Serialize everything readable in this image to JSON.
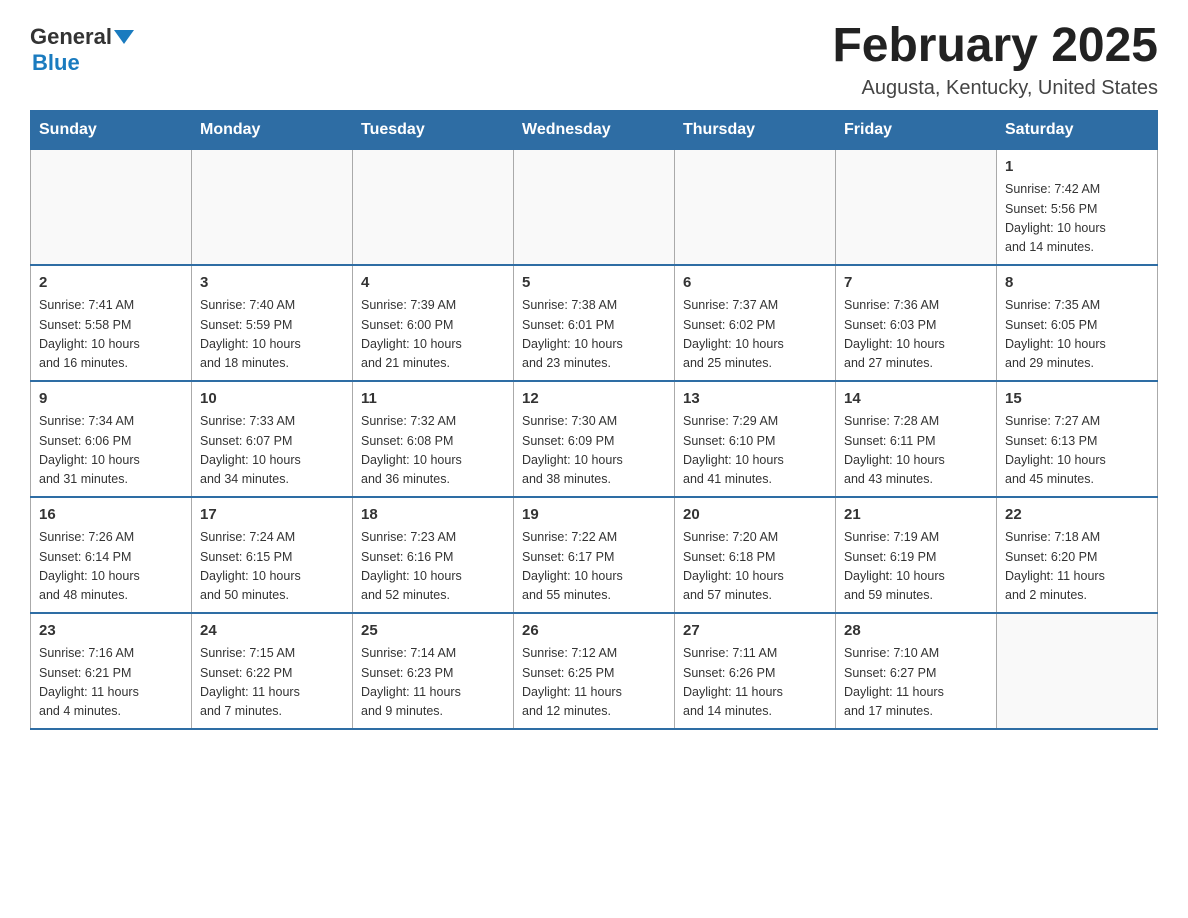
{
  "header": {
    "logo": {
      "general": "General",
      "blue": "Blue"
    },
    "title": "February 2025",
    "subtitle": "Augusta, Kentucky, United States"
  },
  "weekdays": [
    "Sunday",
    "Monday",
    "Tuesday",
    "Wednesday",
    "Thursday",
    "Friday",
    "Saturday"
  ],
  "weeks": [
    [
      {
        "day": "",
        "info": ""
      },
      {
        "day": "",
        "info": ""
      },
      {
        "day": "",
        "info": ""
      },
      {
        "day": "",
        "info": ""
      },
      {
        "day": "",
        "info": ""
      },
      {
        "day": "",
        "info": ""
      },
      {
        "day": "1",
        "info": "Sunrise: 7:42 AM\nSunset: 5:56 PM\nDaylight: 10 hours\nand 14 minutes."
      }
    ],
    [
      {
        "day": "2",
        "info": "Sunrise: 7:41 AM\nSunset: 5:58 PM\nDaylight: 10 hours\nand 16 minutes."
      },
      {
        "day": "3",
        "info": "Sunrise: 7:40 AM\nSunset: 5:59 PM\nDaylight: 10 hours\nand 18 minutes."
      },
      {
        "day": "4",
        "info": "Sunrise: 7:39 AM\nSunset: 6:00 PM\nDaylight: 10 hours\nand 21 minutes."
      },
      {
        "day": "5",
        "info": "Sunrise: 7:38 AM\nSunset: 6:01 PM\nDaylight: 10 hours\nand 23 minutes."
      },
      {
        "day": "6",
        "info": "Sunrise: 7:37 AM\nSunset: 6:02 PM\nDaylight: 10 hours\nand 25 minutes."
      },
      {
        "day": "7",
        "info": "Sunrise: 7:36 AM\nSunset: 6:03 PM\nDaylight: 10 hours\nand 27 minutes."
      },
      {
        "day": "8",
        "info": "Sunrise: 7:35 AM\nSunset: 6:05 PM\nDaylight: 10 hours\nand 29 minutes."
      }
    ],
    [
      {
        "day": "9",
        "info": "Sunrise: 7:34 AM\nSunset: 6:06 PM\nDaylight: 10 hours\nand 31 minutes."
      },
      {
        "day": "10",
        "info": "Sunrise: 7:33 AM\nSunset: 6:07 PM\nDaylight: 10 hours\nand 34 minutes."
      },
      {
        "day": "11",
        "info": "Sunrise: 7:32 AM\nSunset: 6:08 PM\nDaylight: 10 hours\nand 36 minutes."
      },
      {
        "day": "12",
        "info": "Sunrise: 7:30 AM\nSunset: 6:09 PM\nDaylight: 10 hours\nand 38 minutes."
      },
      {
        "day": "13",
        "info": "Sunrise: 7:29 AM\nSunset: 6:10 PM\nDaylight: 10 hours\nand 41 minutes."
      },
      {
        "day": "14",
        "info": "Sunrise: 7:28 AM\nSunset: 6:11 PM\nDaylight: 10 hours\nand 43 minutes."
      },
      {
        "day": "15",
        "info": "Sunrise: 7:27 AM\nSunset: 6:13 PM\nDaylight: 10 hours\nand 45 minutes."
      }
    ],
    [
      {
        "day": "16",
        "info": "Sunrise: 7:26 AM\nSunset: 6:14 PM\nDaylight: 10 hours\nand 48 minutes."
      },
      {
        "day": "17",
        "info": "Sunrise: 7:24 AM\nSunset: 6:15 PM\nDaylight: 10 hours\nand 50 minutes."
      },
      {
        "day": "18",
        "info": "Sunrise: 7:23 AM\nSunset: 6:16 PM\nDaylight: 10 hours\nand 52 minutes."
      },
      {
        "day": "19",
        "info": "Sunrise: 7:22 AM\nSunset: 6:17 PM\nDaylight: 10 hours\nand 55 minutes."
      },
      {
        "day": "20",
        "info": "Sunrise: 7:20 AM\nSunset: 6:18 PM\nDaylight: 10 hours\nand 57 minutes."
      },
      {
        "day": "21",
        "info": "Sunrise: 7:19 AM\nSunset: 6:19 PM\nDaylight: 10 hours\nand 59 minutes."
      },
      {
        "day": "22",
        "info": "Sunrise: 7:18 AM\nSunset: 6:20 PM\nDaylight: 11 hours\nand 2 minutes."
      }
    ],
    [
      {
        "day": "23",
        "info": "Sunrise: 7:16 AM\nSunset: 6:21 PM\nDaylight: 11 hours\nand 4 minutes."
      },
      {
        "day": "24",
        "info": "Sunrise: 7:15 AM\nSunset: 6:22 PM\nDaylight: 11 hours\nand 7 minutes."
      },
      {
        "day": "25",
        "info": "Sunrise: 7:14 AM\nSunset: 6:23 PM\nDaylight: 11 hours\nand 9 minutes."
      },
      {
        "day": "26",
        "info": "Sunrise: 7:12 AM\nSunset: 6:25 PM\nDaylight: 11 hours\nand 12 minutes."
      },
      {
        "day": "27",
        "info": "Sunrise: 7:11 AM\nSunset: 6:26 PM\nDaylight: 11 hours\nand 14 minutes."
      },
      {
        "day": "28",
        "info": "Sunrise: 7:10 AM\nSunset: 6:27 PM\nDaylight: 11 hours\nand 17 minutes."
      },
      {
        "day": "",
        "info": ""
      }
    ]
  ]
}
